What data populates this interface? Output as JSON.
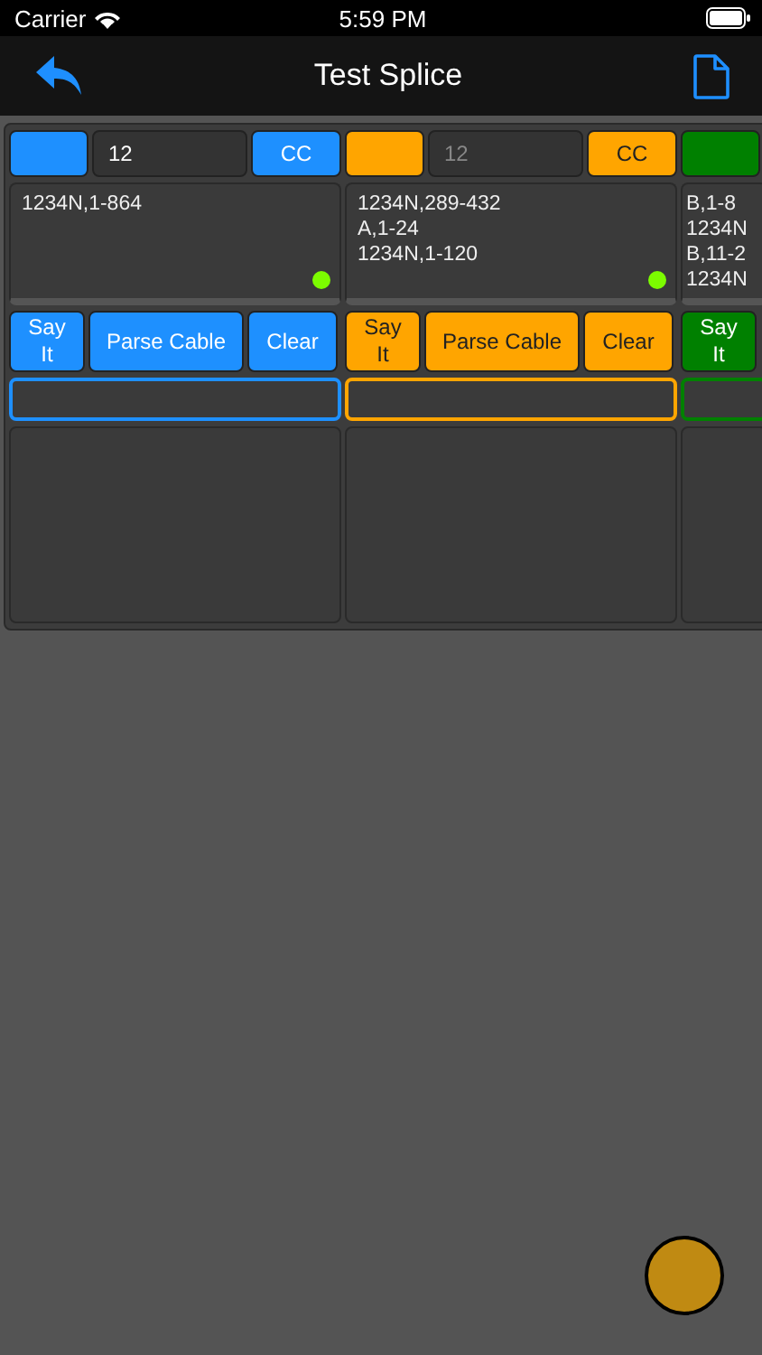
{
  "status_bar": {
    "carrier": "Carrier",
    "time": "5:59 PM"
  },
  "nav": {
    "title": "Test Splice"
  },
  "columns": [
    {
      "color": "#1e90ff",
      "count": {
        "value": "12"
      },
      "cc_label": "CC",
      "lines": [
        "1234N,1-864"
      ],
      "ready": true,
      "buttons": [
        "Say It",
        "Parse Cable",
        "Clear"
      ]
    },
    {
      "color": "#ffa500",
      "count": {
        "placeholder": "12"
      },
      "cc_label": "CC",
      "lines": [
        "1234N,289-432",
        "A,1-24",
        "1234N,1-120"
      ],
      "ready": true,
      "buttons": [
        "Say It",
        "Parse Cable",
        "Clear"
      ]
    },
    {
      "color": "#008000",
      "lines": [
        "B,1-8",
        "1234N",
        "B,11-2",
        "1234N"
      ],
      "buttons": [
        "Say It"
      ]
    }
  ]
}
